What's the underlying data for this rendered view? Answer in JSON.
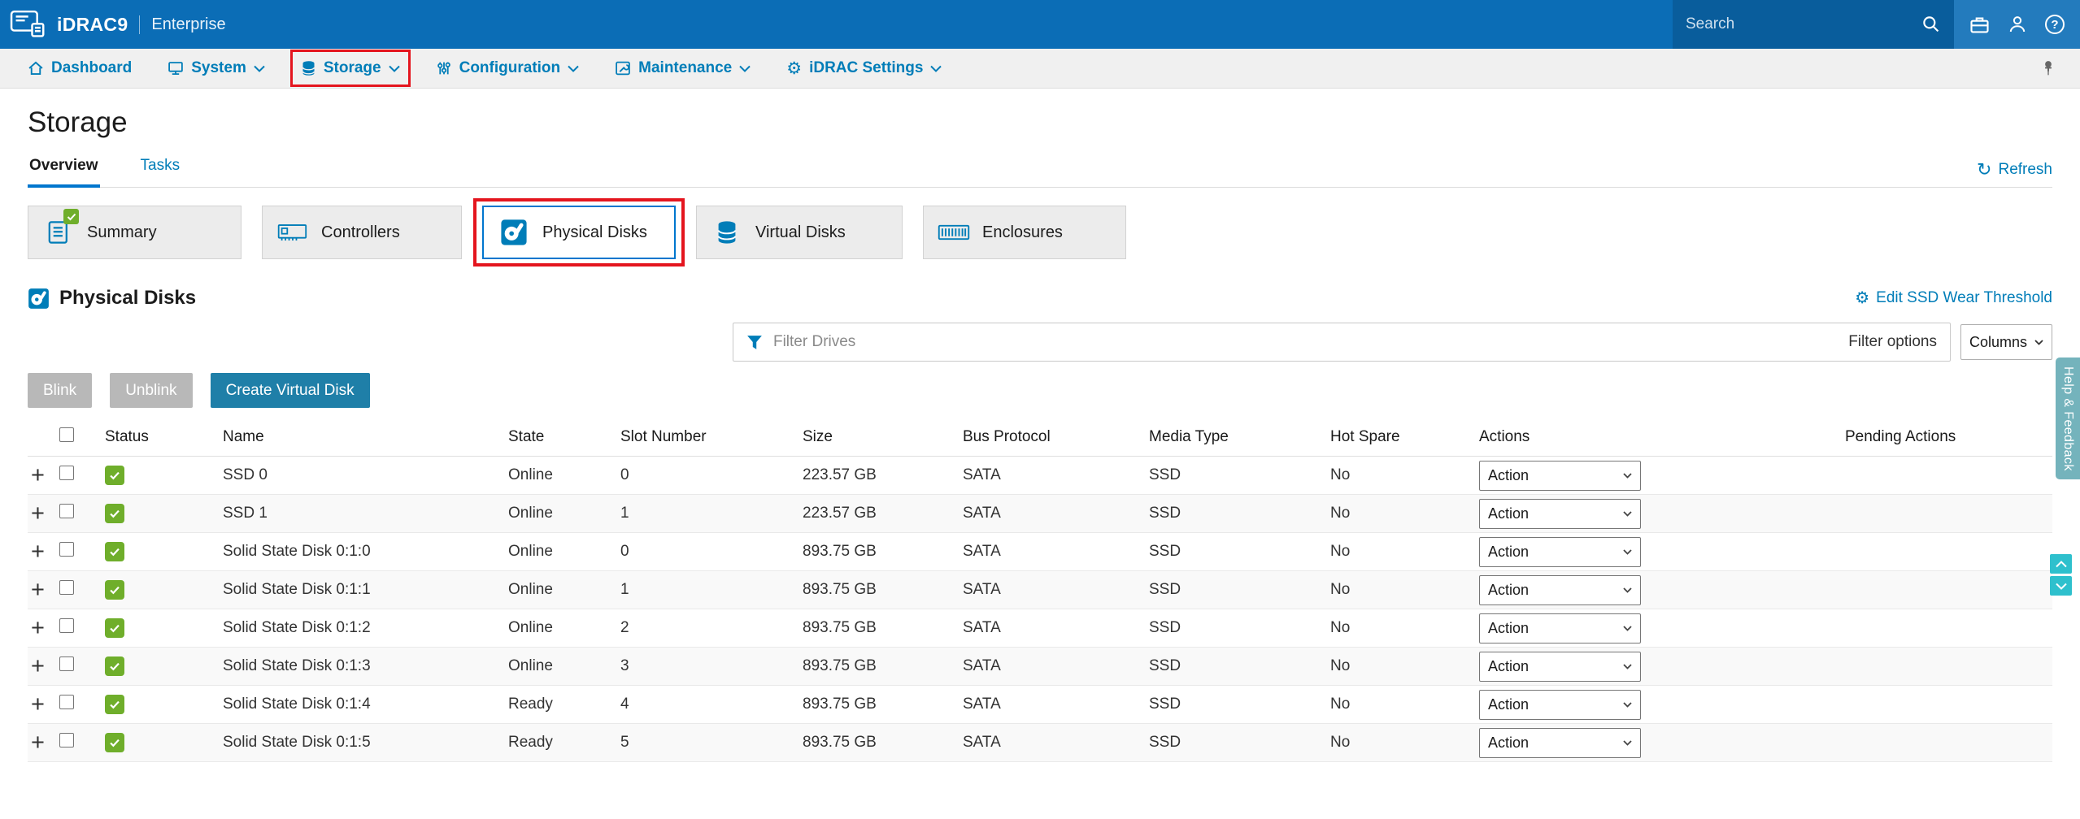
{
  "colors": {
    "header_bg": "#0B6DB6",
    "accent_link": "#007DB8",
    "active_tab_underline": "#0076CE",
    "primary_button": "#1F7FA8",
    "disabled_button": "#B8B8B8",
    "status_ok_green": "#6FAE2B",
    "annotation_red": "#E4151E",
    "help_tab_teal": "#74B3BC",
    "scroll_chevron_cyan": "#2EC0CD",
    "nav_bg": "#F0F0F0"
  },
  "header": {
    "brand": "iDRAC9",
    "edition": "Enterprise",
    "search_placeholder": "Search"
  },
  "nav": {
    "items": [
      {
        "label": "Dashboard"
      },
      {
        "label": "System"
      },
      {
        "label": "Storage"
      },
      {
        "label": "Configuration"
      },
      {
        "label": "Maintenance"
      },
      {
        "label": "iDRAC Settings"
      }
    ]
  },
  "page": {
    "title": "Storage",
    "tabs": [
      {
        "label": "Overview"
      },
      {
        "label": "Tasks"
      }
    ],
    "refresh_label": "Refresh"
  },
  "cards": [
    {
      "label": "Summary"
    },
    {
      "label": "Controllers"
    },
    {
      "label": "Physical Disks"
    },
    {
      "label": "Virtual Disks"
    },
    {
      "label": "Enclosures"
    }
  ],
  "section": {
    "title": "Physical Disks",
    "edit_link_label": "Edit SSD Wear Threshold"
  },
  "filter": {
    "placeholder": "Filter Drives",
    "options_label": "Filter options",
    "columns_label": "Columns"
  },
  "toolbar": {
    "blink_label": "Blink",
    "unblink_label": "Unblink",
    "create_label": "Create Virtual Disk"
  },
  "table": {
    "columns": [
      "Status",
      "Name",
      "State",
      "Slot Number",
      "Size",
      "Bus Protocol",
      "Media Type",
      "Hot Spare",
      "Actions",
      "Pending Actions"
    ],
    "rows": [
      {
        "name": "SSD 0",
        "state": "Online",
        "slot": "0",
        "size": "223.57 GB",
        "bus": "SATA",
        "media": "SSD",
        "hot_spare": "No",
        "action": "Action",
        "pending": ""
      },
      {
        "name": "SSD 1",
        "state": "Online",
        "slot": "1",
        "size": "223.57 GB",
        "bus": "SATA",
        "media": "SSD",
        "hot_spare": "No",
        "action": "Action",
        "pending": ""
      },
      {
        "name": "Solid State Disk 0:1:0",
        "state": "Online",
        "slot": "0",
        "size": "893.75 GB",
        "bus": "SATA",
        "media": "SSD",
        "hot_spare": "No",
        "action": "Action",
        "pending": ""
      },
      {
        "name": "Solid State Disk 0:1:1",
        "state": "Online",
        "slot": "1",
        "size": "893.75 GB",
        "bus": "SATA",
        "media": "SSD",
        "hot_spare": "No",
        "action": "Action",
        "pending": ""
      },
      {
        "name": "Solid State Disk 0:1:2",
        "state": "Online",
        "slot": "2",
        "size": "893.75 GB",
        "bus": "SATA",
        "media": "SSD",
        "hot_spare": "No",
        "action": "Action",
        "pending": ""
      },
      {
        "name": "Solid State Disk 0:1:3",
        "state": "Online",
        "slot": "3",
        "size": "893.75 GB",
        "bus": "SATA",
        "media": "SSD",
        "hot_spare": "No",
        "action": "Action",
        "pending": ""
      },
      {
        "name": "Solid State Disk 0:1:4",
        "state": "Ready",
        "slot": "4",
        "size": "893.75 GB",
        "bus": "SATA",
        "media": "SSD",
        "hot_spare": "No",
        "action": "Action",
        "pending": ""
      },
      {
        "name": "Solid State Disk 0:1:5",
        "state": "Ready",
        "slot": "5",
        "size": "893.75 GB",
        "bus": "SATA",
        "media": "SSD",
        "hot_spare": "No",
        "action": "Action",
        "pending": ""
      }
    ]
  },
  "side": {
    "help_label": "Help & Feedback"
  }
}
